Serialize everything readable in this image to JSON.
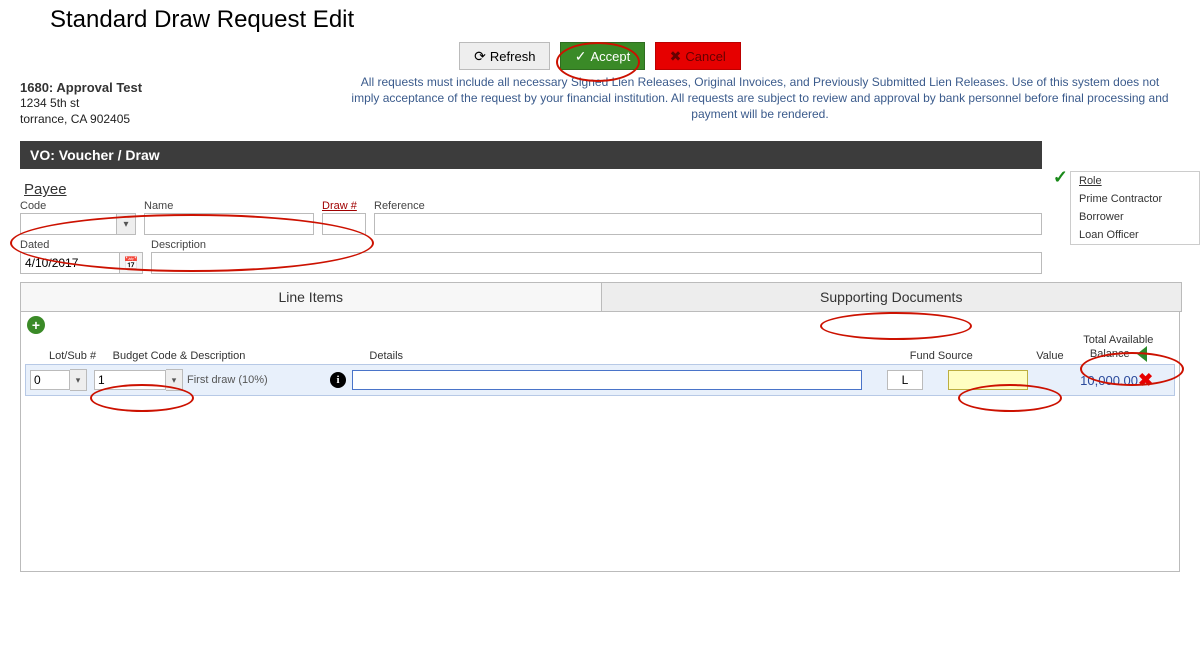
{
  "page_title": "Standard Draw Request Edit",
  "toolbar": {
    "refresh_label": "Refresh",
    "accept_label": "Accept",
    "cancel_label": "Cancel"
  },
  "approval": {
    "title": "1680: Approval Test",
    "addr1": "1234 5th st",
    "addr2": "torrance, CA  902405"
  },
  "disclaimer": "All requests must include all necessary Signed Lien Releases, Original Invoices, and Previously Submitted Lien Releases.  Use of this system does not imply acceptance of the request by your financial institution.  All requests are subject to review and approval by bank personnel before final processing and payment will be rendered.",
  "section_title": "VO: Voucher / Draw",
  "roles": {
    "header": "Role",
    "items": [
      "Prime Contractor",
      "Borrower",
      "Loan Officer"
    ]
  },
  "payee_label": "Payee",
  "fields": {
    "code_label": "Code",
    "code_value": "",
    "name_label": "Name",
    "name_value": "",
    "draw_label": "Draw #",
    "draw_value": "",
    "reference_label": "Reference",
    "reference_value": "",
    "dated_label": "Dated",
    "dated_value": "4/10/2017",
    "description_label": "Description",
    "description_value": ""
  },
  "tabs": {
    "line_items": "Line Items",
    "supporting_docs": "Supporting Documents"
  },
  "grid": {
    "headers": {
      "lot": "Lot/Sub #",
      "budget": "Budget Code & Description",
      "details": "Details",
      "fund": "Fund Source",
      "value": "Value",
      "total": "Total Available Balance"
    },
    "rows": [
      {
        "lot": "0",
        "budget_code": "1",
        "budget_desc": "First draw (10%)",
        "details": "",
        "fund": "L",
        "value": "",
        "total": "10,000.00"
      }
    ]
  }
}
